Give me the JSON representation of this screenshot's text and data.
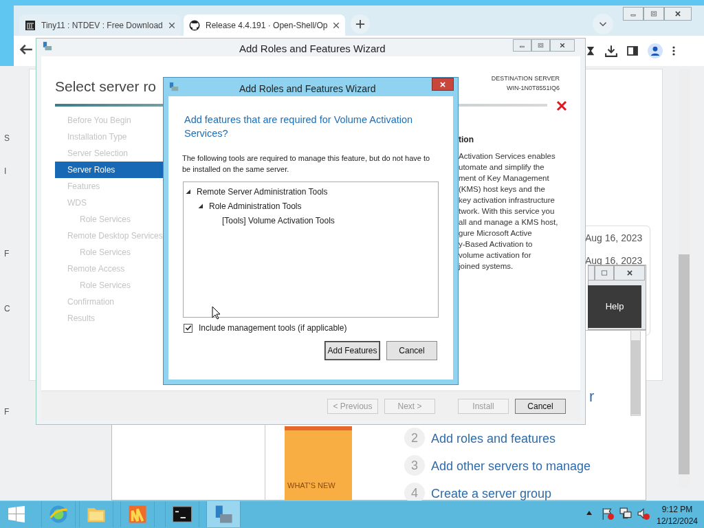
{
  "browser": {
    "tabs": [
      {
        "label": "Tiny11 : NTDEV : Free Download",
        "selected": false
      },
      {
        "label": "Release 4.4.191 · Open-Shell/Op",
        "selected": true
      }
    ],
    "page_dates": [
      "Aug 16, 2023",
      "Aug 16, 2023"
    ]
  },
  "left_edge_letters": [
    "S",
    "I",
    "F",
    "C",
    "F"
  ],
  "server_manager": {
    "heading_fragment": "r",
    "tile": "WHAT'S NEW",
    "steps": [
      {
        "number": "2",
        "label": "Add roles and features"
      },
      {
        "number": "3",
        "label": "Add other servers to manage"
      },
      {
        "number": "4",
        "label": "Create a server group"
      }
    ],
    "help_panel": "Help"
  },
  "wizard": {
    "title": "Add Roles and Features Wizard",
    "heading": "Select server ro",
    "destination_label": "DESTINATION SERVER",
    "destination_server": "WIN-1N0T8551IQ6",
    "nav": [
      {
        "label": "Before You Begin",
        "selected": false
      },
      {
        "label": "Installation Type",
        "selected": false
      },
      {
        "label": "Server Selection",
        "selected": false
      },
      {
        "label": "Server Roles",
        "selected": true
      },
      {
        "label": "Features",
        "selected": false
      },
      {
        "label": "WDS",
        "selected": false,
        "children": [
          {
            "label": "Role Services",
            "selected": false
          }
        ]
      },
      {
        "label": "Remote Desktop Services",
        "selected": false,
        "children": [
          {
            "label": "Role Services",
            "selected": false
          }
        ]
      },
      {
        "label": "Remote Access",
        "selected": false,
        "children": [
          {
            "label": "Role Services",
            "selected": false
          }
        ]
      },
      {
        "label": "Confirmation",
        "selected": false
      },
      {
        "label": "Results",
        "selected": false
      }
    ],
    "description_title": "tion",
    "description_lines": [
      "Activation Services enables",
      "utomate and simplify the",
      "ment of Key Management",
      "(KMS) host keys and the",
      "key activation infrastructure",
      "twork. With this service you",
      "all and manage a KMS host,",
      "gure Microsoft Active",
      "y-Based Activation to",
      "volume activation for",
      "joined systems."
    ],
    "buttons": [
      {
        "label": "< Previous",
        "disabled": true
      },
      {
        "label": "Next >",
        "disabled": true
      },
      {
        "label": "Install",
        "disabled": true
      },
      {
        "label": "Cancel",
        "disabled": false
      }
    ]
  },
  "dialog": {
    "title": "Add Roles and Features Wizard",
    "question": "Add features that are required for Volume Activation Services?",
    "explanation": "The following tools are required to manage this feature, but do not have to be installed on the same server.",
    "tree": [
      {
        "label": "Remote Server Administration Tools",
        "expanded": true,
        "children": [
          {
            "label": "Role Administration Tools",
            "expanded": true,
            "children": [
              {
                "label": "[Tools] Volume Activation Tools"
              }
            ]
          }
        ]
      }
    ],
    "include_tools": {
      "label": "Include management tools (if applicable)",
      "checked": true
    },
    "buttons": [
      {
        "label": "Add Features",
        "default": true
      },
      {
        "label": "Cancel",
        "default": false
      }
    ]
  },
  "taskbar": {
    "apps": [
      {
        "kind": "browser",
        "selected": false
      },
      {
        "kind": "folder",
        "selected": false
      },
      {
        "kind": "tiles",
        "selected": false
      },
      {
        "kind": "console",
        "selected": false
      },
      {
        "kind": "server",
        "selected": true
      }
    ],
    "time": "9:12 PM",
    "date": "12/12/2024"
  }
}
